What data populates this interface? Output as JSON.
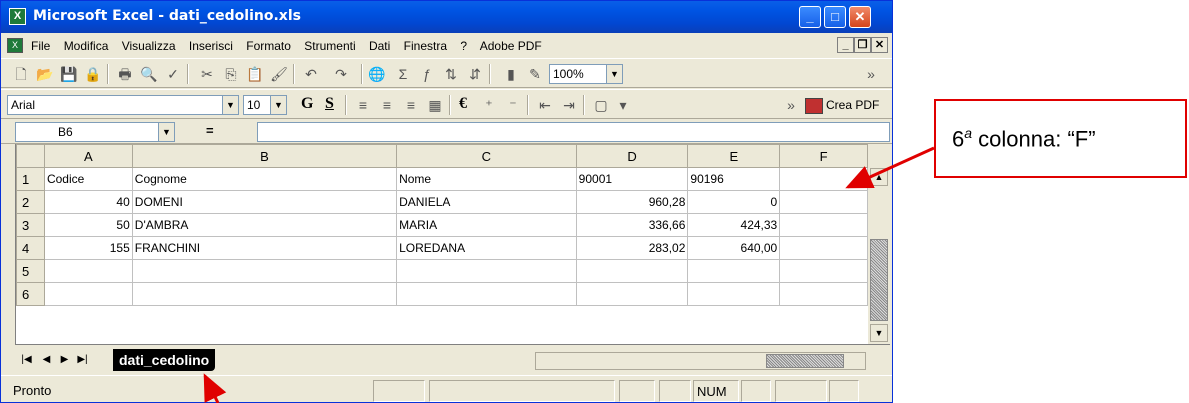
{
  "window": {
    "title": "Microsoft Excel - dati_cedolino.xls",
    "excel_icon": "excel-icon",
    "buttons": [
      "minimize",
      "maximize",
      "close"
    ],
    "minimize_glyph": "_",
    "maximize_glyph": "□",
    "close_glyph": "✕"
  },
  "menubar": {
    "items": [
      "File",
      "Modifica",
      "Visualizza",
      "Inserisci",
      "Formato",
      "Strumenti",
      "Dati",
      "Finestra",
      "?",
      "Adobe PDF"
    ]
  },
  "toolbar": {
    "zoom": "100%"
  },
  "format_toolbar": {
    "font": "Arial",
    "size": "10",
    "bold_label": "G",
    "underline_label": "S",
    "euro": "€",
    "crea_pdf": "Crea PDF"
  },
  "formula_bar": {
    "cell_ref": "B6",
    "equals": "=",
    "value": ""
  },
  "sheet": {
    "columns": [
      "A",
      "B",
      "C",
      "D",
      "E",
      "F"
    ],
    "rows": [
      {
        "n": "1",
        "cells": [
          "Codice",
          "Cognome",
          "Nome",
          "90001",
          "90196",
          ""
        ]
      },
      {
        "n": "2",
        "cells": [
          "40",
          "DOMENI",
          "DANIELA",
          "960,28",
          "0",
          ""
        ]
      },
      {
        "n": "3",
        "cells": [
          "50",
          "D'AMBRA",
          "MARIA",
          "336,66",
          "424,33",
          ""
        ]
      },
      {
        "n": "4",
        "cells": [
          "155",
          "FRANCHINI",
          "LOREDANA",
          "283,02",
          "640,00",
          ""
        ]
      },
      {
        "n": "5",
        "cells": [
          "",
          "",
          "",
          "",
          "",
          ""
        ]
      },
      {
        "n": "6",
        "cells": [
          "",
          "",
          "",
          "",
          "",
          ""
        ]
      }
    ]
  },
  "tabs": {
    "active": "dati_cedolino"
  },
  "statusbar": {
    "text": "Pronto",
    "num": "NUM"
  },
  "annotation": {
    "number": "6",
    "superscript": "a",
    "rest": " colonna: “F”",
    "color": "#e00000"
  }
}
